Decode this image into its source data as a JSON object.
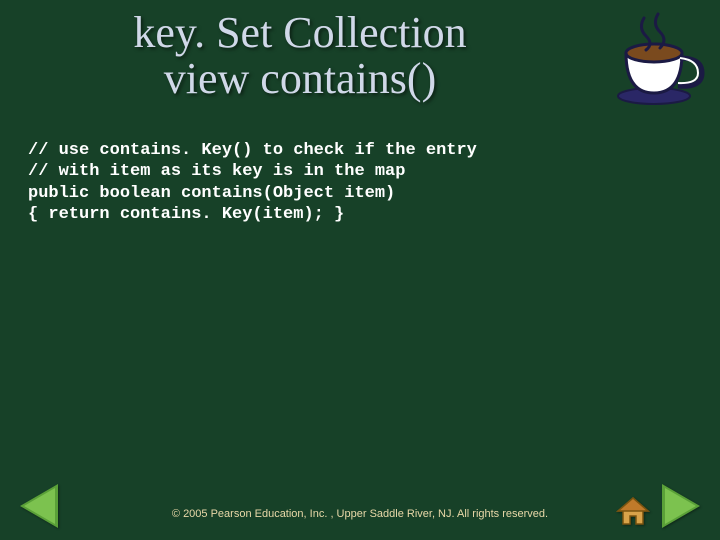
{
  "title_line1": "key. Set Collection",
  "title_line2": "view contains()",
  "code": {
    "line1": "// use contains. Key() to check if the entry",
    "line2": "// with item as its key is in the map",
    "line3": "public boolean contains(Object item)",
    "line4": "{ return contains. Key(item); }"
  },
  "footer": "© 2005 Pearson Education, Inc. , Upper Saddle River, NJ.  All rights reserved.",
  "icons": {
    "cup": "coffee-cup-icon",
    "home": "home-icon",
    "prev": "previous-arrow",
    "next": "next-arrow"
  },
  "colors": {
    "background": "#174128",
    "title": "#d0d8e8",
    "code": "#ffffff",
    "footer": "#e8d8a8",
    "arrow": "#7cc24f"
  }
}
